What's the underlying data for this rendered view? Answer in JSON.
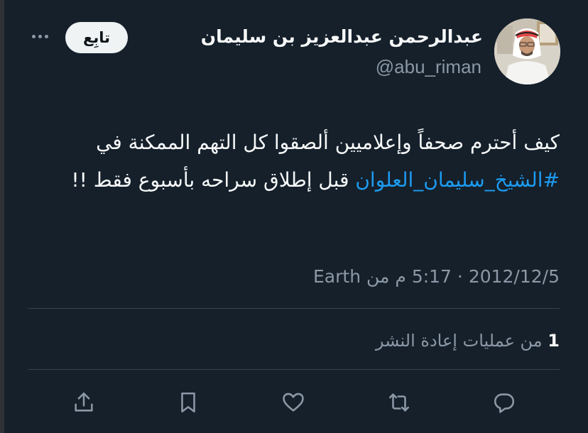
{
  "header": {
    "more_icon": "more-horizontal-icon",
    "follow_label": "تابِع",
    "display_name": "عبدالرحمن عبدالعزيز بن سليمان",
    "handle": "@abu_riman",
    "avatar": "profile-photo"
  },
  "tweet": {
    "text_part1": "كيف أحترم صحفاً وإعلاميين ألصقوا كل التهم الممكنة في ",
    "hashtag": "#الشيخ_سليمان_العلوان",
    "text_part2": " قبل إطلاق سراحه بأسبوع فقط !!"
  },
  "meta": {
    "time": "5:17 م",
    "separator": "·",
    "date": "2012/12/5",
    "from_label": "من",
    "source": "Earth"
  },
  "stats": {
    "reposts_count": "1",
    "reposts_label": "من عمليات إعادة النشر"
  },
  "actions": [
    {
      "name": "share",
      "icon": "share-icon"
    },
    {
      "name": "bookmark",
      "icon": "bookmark-icon"
    },
    {
      "name": "like",
      "icon": "heart-icon"
    },
    {
      "name": "retweet",
      "icon": "retweet-icon"
    },
    {
      "name": "reply",
      "icon": "reply-icon"
    }
  ],
  "colors": {
    "background": "#15202b",
    "text": "#f7f9f9",
    "secondary_text": "#8b98a5",
    "link": "#1d9bf0",
    "follow_button_bg": "#eff3f4",
    "divider": "#38444d"
  }
}
